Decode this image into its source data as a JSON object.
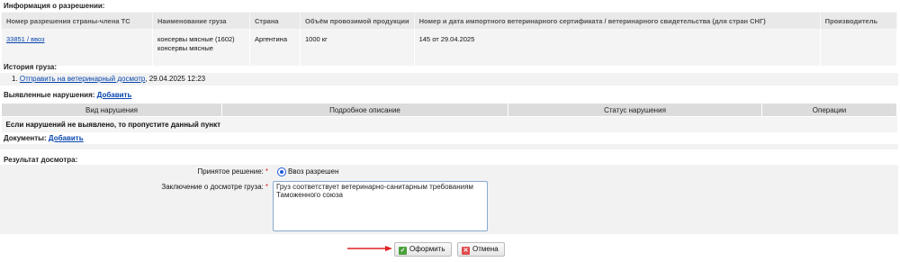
{
  "permit": {
    "title": "Информация о разрешении:",
    "headers": [
      "Номер разрешения страны-члена ТС",
      "Наименование груза",
      "Страна",
      "Объём провозимой продукции",
      "Номер и дата импортного ветеринарного сертификата / ветеринарного свидетельства (для стран СНГ)",
      "Производитель"
    ],
    "row": {
      "number": "33851 / ввоз",
      "cargo_line1": "консервы мясные (1602)",
      "cargo_line2": "консервы мясные",
      "country": "Аргентина",
      "volume": "1000 кг",
      "certificate": "145 от 29.04.2025",
      "producer": ""
    }
  },
  "history": {
    "title": "История груза:",
    "item_num": "1.",
    "item_link": "Отправить на ветеринарный досмотр",
    "item_date": ", 29.04.2025 12:23"
  },
  "violations": {
    "title": "Выявленные нарушения:",
    "add_label": "Добавить",
    "headers": [
      "Вид нарушения",
      "Подробное описание",
      "Статус нарушения",
      "Операции"
    ],
    "empty_message": "Если нарушений не выявлено, то пропустите данный пункт"
  },
  "documents": {
    "title": "Документы:",
    "add_label": "Добавить"
  },
  "result": {
    "title": "Результат досмотра:",
    "decision_label": "Принятое решение:",
    "decision_value": "Ввоз разрешен",
    "conclusion_label": "Заключение о досмотре груза:",
    "conclusion_value": "Груз соответствует ветеринарно-санитарным требованиям Таможенного союза",
    "required_mark": "*"
  },
  "actions": {
    "submit_label": "Оформить",
    "cancel_label": "Отмена"
  },
  "colors": {
    "link": "#0645ad",
    "header_bg": "#e9e9e9",
    "submit_icon": "#4aa13b",
    "cancel_icon": "#e04c4c",
    "arrow": "#e02020"
  }
}
